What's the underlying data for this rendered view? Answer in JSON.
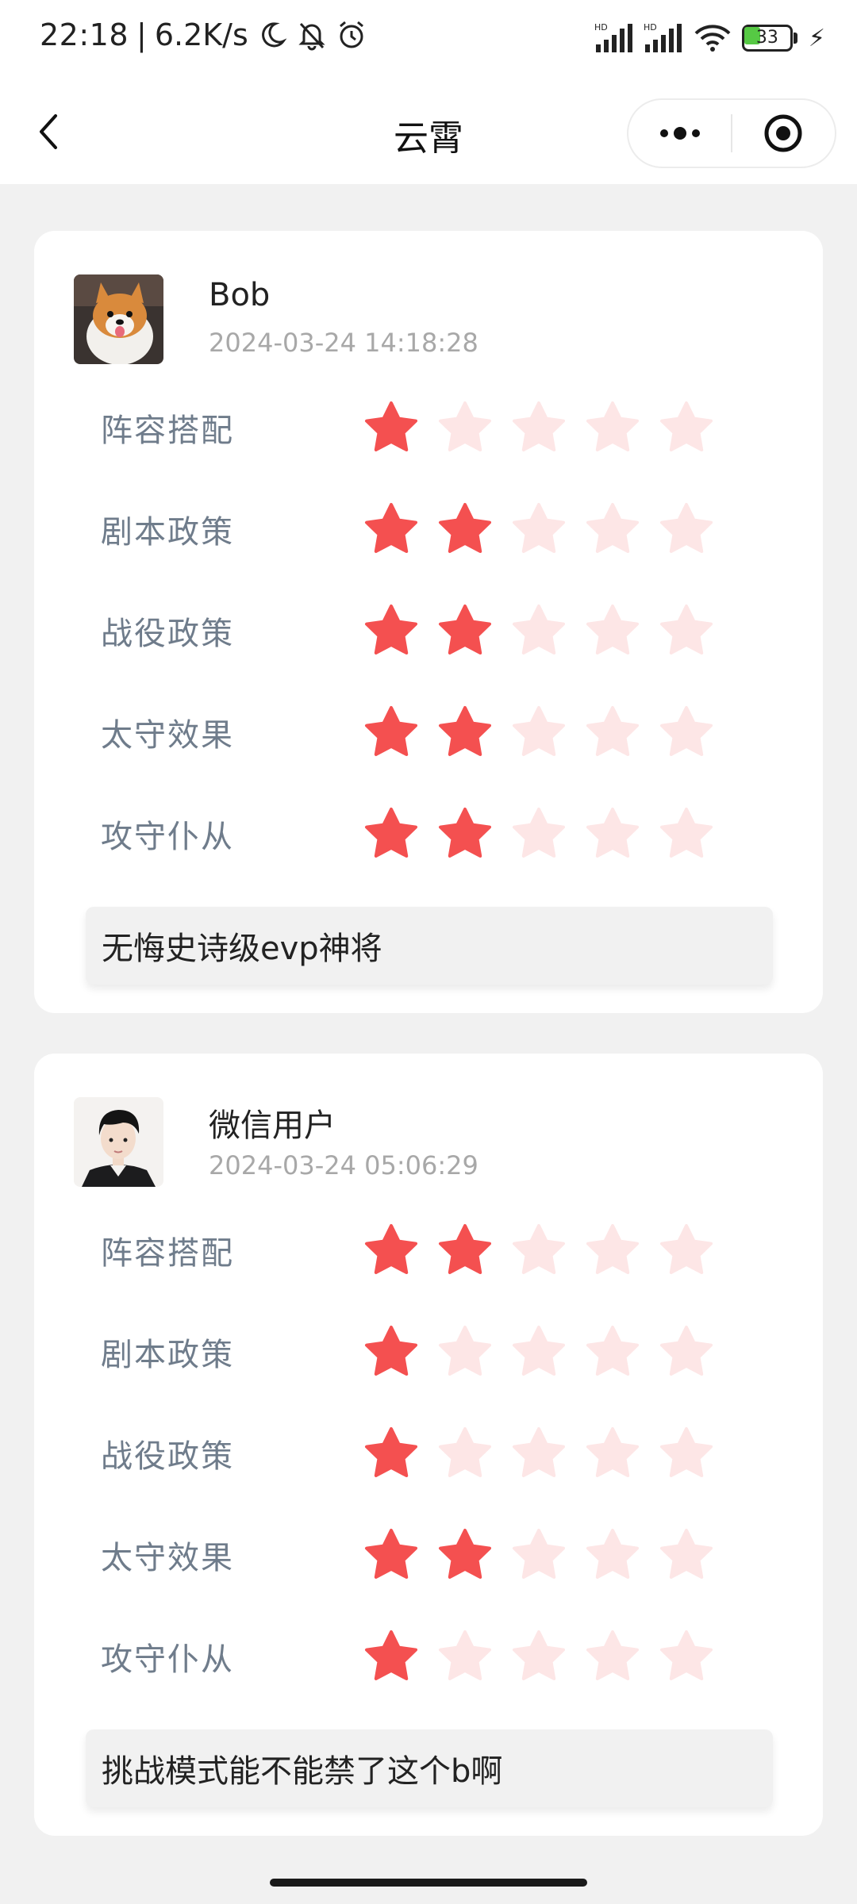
{
  "status": {
    "time": "22:18",
    "speed": "6.2K/s",
    "battery": "33",
    "network_label": "HD"
  },
  "nav": {
    "title": "云霄"
  },
  "colors": {
    "star_on": "#f45050",
    "star_off": "#fde6e6",
    "label": "#6f7c8b"
  },
  "reviews": [
    {
      "user": "Bob",
      "time": "2024-03-24 14:18:28",
      "ratings": [
        {
          "label": "阵容搭配",
          "score": 1,
          "max": 5
        },
        {
          "label": "剧本政策",
          "score": 2,
          "max": 5
        },
        {
          "label": "战役政策",
          "score": 2,
          "max": 5
        },
        {
          "label": "太守效果",
          "score": 2,
          "max": 5
        },
        {
          "label": "攻守仆从",
          "score": 2,
          "max": 5
        }
      ],
      "comment": "无悔史诗级evp神将"
    },
    {
      "user": "微信用户",
      "time": "2024-03-24 05:06:29",
      "ratings": [
        {
          "label": "阵容搭配",
          "score": 2,
          "max": 5
        },
        {
          "label": "剧本政策",
          "score": 1,
          "max": 5
        },
        {
          "label": "战役政策",
          "score": 1,
          "max": 5
        },
        {
          "label": "太守效果",
          "score": 2,
          "max": 5
        },
        {
          "label": "攻守仆从",
          "score": 1,
          "max": 5
        }
      ],
      "comment": "挑战模式能不能禁了这个b啊"
    }
  ]
}
